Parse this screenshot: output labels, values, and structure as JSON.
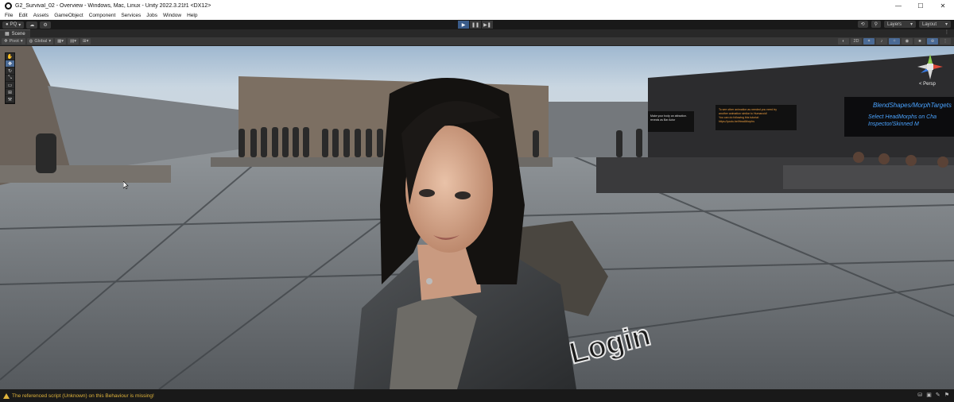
{
  "window": {
    "title": "G2_Survival_02 - Overview - Windows, Mac, Linux - Unity 2022.3.21f1 <DX12>",
    "controls": [
      "—",
      "☐",
      "✕"
    ]
  },
  "menu": [
    "File",
    "Edit",
    "Assets",
    "GameObject",
    "Component",
    "Services",
    "Jobs",
    "Window",
    "Help"
  ],
  "toolbar": {
    "account_label": "PQ",
    "layers_label": "Layers",
    "layout_label": "Layout"
  },
  "scene_tab": {
    "label": "Scene"
  },
  "scene_toolbar": {
    "pivot_label": "Pivot",
    "global_label": "Global"
  },
  "viewport": {
    "projection_label": "< Persp",
    "floor_text": "Login",
    "signs": [
      "Make your body an attraction.\nreveals as Bar Actor",
      "To see other animation as needed you need try\nanother animation similar to Humanoid!\nYou can do following this tutorial:\nhttps://youtu.be/HeadMorphs",
      "BlendShapes/MorphTargets",
      "Select HeadMorphs on Cha\nInspector/Skinned M"
    ]
  },
  "status": {
    "message": "The referenced script (Unknown) on this Behaviour is missing!"
  },
  "colors": {
    "editor_bg": "#191919",
    "panel": "#383838",
    "accent": "#4a6a95",
    "warning": "#e0b43c",
    "sign_text": "#4aa3ff"
  }
}
